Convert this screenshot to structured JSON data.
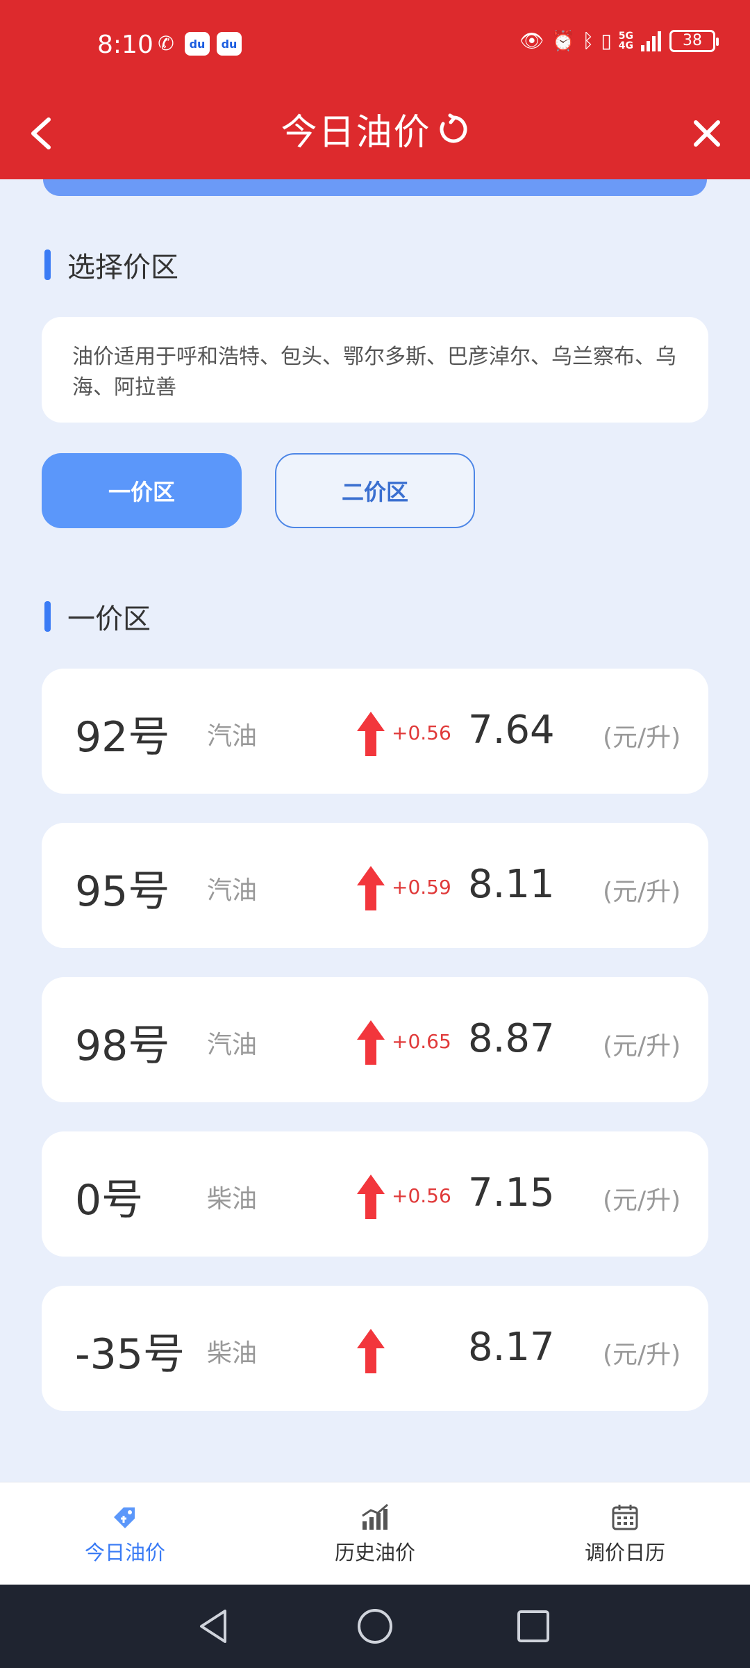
{
  "status_bar": {
    "time": "8:10",
    "battery": "38",
    "network": [
      "5G",
      "4G"
    ]
  },
  "header": {
    "title": "今日油价"
  },
  "zone_section": {
    "title": "选择价区",
    "note": "油价适用于呼和浩特、包头、鄂尔多斯、巴彦淖尔、乌兰察布、乌海、阿拉善",
    "buttons": [
      {
        "label": "一价区",
        "active": true
      },
      {
        "label": "二价区",
        "active": false
      }
    ]
  },
  "price_section": {
    "title": "一价区",
    "items": [
      {
        "grade": "92号",
        "type": "汽油",
        "change": "+0.56",
        "price": "7.64",
        "unit": "(元/升)"
      },
      {
        "grade": "95号",
        "type": "汽油",
        "change": "+0.59",
        "price": "8.11",
        "unit": "(元/升)"
      },
      {
        "grade": "98号",
        "type": "汽油",
        "change": "+0.65",
        "price": "8.87",
        "unit": "(元/升)"
      },
      {
        "grade": "0号",
        "type": "柴油",
        "change": "+0.56",
        "price": "7.15",
        "unit": "(元/升)"
      },
      {
        "grade": "-35号",
        "type": "柴油",
        "change": "",
        "price": "8.17",
        "unit": "(元/升)"
      }
    ]
  },
  "tabs": [
    {
      "label": "今日油价",
      "icon": "price-tag-icon",
      "active": true
    },
    {
      "label": "历史油价",
      "icon": "bar-chart-icon",
      "active": false
    },
    {
      "label": "调价日历",
      "icon": "calendar-icon",
      "active": false
    }
  ],
  "colors": {
    "header_red": "#dd2a2d",
    "accent_blue": "#3a7bf5",
    "rise_red": "#e03a3a",
    "page_bg": "#e9effb"
  }
}
